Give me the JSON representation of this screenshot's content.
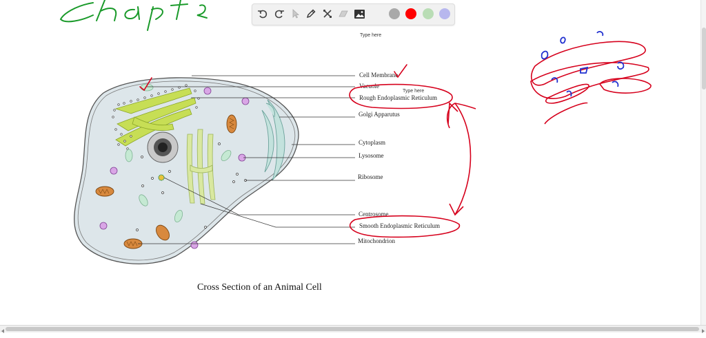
{
  "toolbar": {
    "tools": [
      "undo-icon",
      "redo-icon",
      "select-icon",
      "pen-icon",
      "tools-icon",
      "highlighter-icon",
      "image-icon"
    ],
    "colors": [
      "#a9a9a9",
      "#ff0000",
      "#b9ddb5",
      "#b7b7ee"
    ]
  },
  "canvas": {
    "type_here_top": "Type here",
    "type_here_inline": "Type here",
    "handwriting": "Chapter",
    "ink_red": "#d6001c",
    "ink_green": "#1a9a2a",
    "ink_blue": "#1f2fcf"
  },
  "diagram": {
    "labels": [
      "Cell Membrane",
      "Vacuole",
      "Rough Endoplasmic Reticulum",
      "Golgi Apparutus",
      "Cytoplasm",
      "Lysosome",
      "Ribosome",
      "Centrosome",
      "Smooth Endoplasmic Reticulum",
      "Mitochondrion"
    ],
    "caption": "Cross Section of an Animal Cell"
  }
}
